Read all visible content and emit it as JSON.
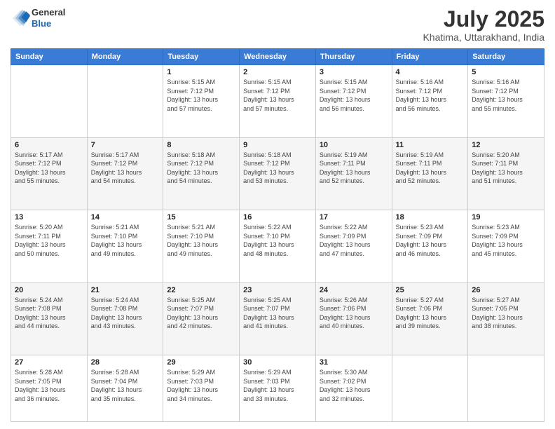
{
  "logo": {
    "line1": "General",
    "line2": "Blue"
  },
  "title": "July 2025",
  "subtitle": "Khatima, Uttarakhand, India",
  "days_of_week": [
    "Sunday",
    "Monday",
    "Tuesday",
    "Wednesday",
    "Thursday",
    "Friday",
    "Saturday"
  ],
  "weeks": [
    [
      {
        "day": "",
        "info": ""
      },
      {
        "day": "",
        "info": ""
      },
      {
        "day": "1",
        "info": "Sunrise: 5:15 AM\nSunset: 7:12 PM\nDaylight: 13 hours\nand 57 minutes."
      },
      {
        "day": "2",
        "info": "Sunrise: 5:15 AM\nSunset: 7:12 PM\nDaylight: 13 hours\nand 57 minutes."
      },
      {
        "day": "3",
        "info": "Sunrise: 5:15 AM\nSunset: 7:12 PM\nDaylight: 13 hours\nand 56 minutes."
      },
      {
        "day": "4",
        "info": "Sunrise: 5:16 AM\nSunset: 7:12 PM\nDaylight: 13 hours\nand 56 minutes."
      },
      {
        "day": "5",
        "info": "Sunrise: 5:16 AM\nSunset: 7:12 PM\nDaylight: 13 hours\nand 55 minutes."
      }
    ],
    [
      {
        "day": "6",
        "info": "Sunrise: 5:17 AM\nSunset: 7:12 PM\nDaylight: 13 hours\nand 55 minutes."
      },
      {
        "day": "7",
        "info": "Sunrise: 5:17 AM\nSunset: 7:12 PM\nDaylight: 13 hours\nand 54 minutes."
      },
      {
        "day": "8",
        "info": "Sunrise: 5:18 AM\nSunset: 7:12 PM\nDaylight: 13 hours\nand 54 minutes."
      },
      {
        "day": "9",
        "info": "Sunrise: 5:18 AM\nSunset: 7:12 PM\nDaylight: 13 hours\nand 53 minutes."
      },
      {
        "day": "10",
        "info": "Sunrise: 5:19 AM\nSunset: 7:11 PM\nDaylight: 13 hours\nand 52 minutes."
      },
      {
        "day": "11",
        "info": "Sunrise: 5:19 AM\nSunset: 7:11 PM\nDaylight: 13 hours\nand 52 minutes."
      },
      {
        "day": "12",
        "info": "Sunrise: 5:20 AM\nSunset: 7:11 PM\nDaylight: 13 hours\nand 51 minutes."
      }
    ],
    [
      {
        "day": "13",
        "info": "Sunrise: 5:20 AM\nSunset: 7:11 PM\nDaylight: 13 hours\nand 50 minutes."
      },
      {
        "day": "14",
        "info": "Sunrise: 5:21 AM\nSunset: 7:10 PM\nDaylight: 13 hours\nand 49 minutes."
      },
      {
        "day": "15",
        "info": "Sunrise: 5:21 AM\nSunset: 7:10 PM\nDaylight: 13 hours\nand 49 minutes."
      },
      {
        "day": "16",
        "info": "Sunrise: 5:22 AM\nSunset: 7:10 PM\nDaylight: 13 hours\nand 48 minutes."
      },
      {
        "day": "17",
        "info": "Sunrise: 5:22 AM\nSunset: 7:09 PM\nDaylight: 13 hours\nand 47 minutes."
      },
      {
        "day": "18",
        "info": "Sunrise: 5:23 AM\nSunset: 7:09 PM\nDaylight: 13 hours\nand 46 minutes."
      },
      {
        "day": "19",
        "info": "Sunrise: 5:23 AM\nSunset: 7:09 PM\nDaylight: 13 hours\nand 45 minutes."
      }
    ],
    [
      {
        "day": "20",
        "info": "Sunrise: 5:24 AM\nSunset: 7:08 PM\nDaylight: 13 hours\nand 44 minutes."
      },
      {
        "day": "21",
        "info": "Sunrise: 5:24 AM\nSunset: 7:08 PM\nDaylight: 13 hours\nand 43 minutes."
      },
      {
        "day": "22",
        "info": "Sunrise: 5:25 AM\nSunset: 7:07 PM\nDaylight: 13 hours\nand 42 minutes."
      },
      {
        "day": "23",
        "info": "Sunrise: 5:25 AM\nSunset: 7:07 PM\nDaylight: 13 hours\nand 41 minutes."
      },
      {
        "day": "24",
        "info": "Sunrise: 5:26 AM\nSunset: 7:06 PM\nDaylight: 13 hours\nand 40 minutes."
      },
      {
        "day": "25",
        "info": "Sunrise: 5:27 AM\nSunset: 7:06 PM\nDaylight: 13 hours\nand 39 minutes."
      },
      {
        "day": "26",
        "info": "Sunrise: 5:27 AM\nSunset: 7:05 PM\nDaylight: 13 hours\nand 38 minutes."
      }
    ],
    [
      {
        "day": "27",
        "info": "Sunrise: 5:28 AM\nSunset: 7:05 PM\nDaylight: 13 hours\nand 36 minutes."
      },
      {
        "day": "28",
        "info": "Sunrise: 5:28 AM\nSunset: 7:04 PM\nDaylight: 13 hours\nand 35 minutes."
      },
      {
        "day": "29",
        "info": "Sunrise: 5:29 AM\nSunset: 7:03 PM\nDaylight: 13 hours\nand 34 minutes."
      },
      {
        "day": "30",
        "info": "Sunrise: 5:29 AM\nSunset: 7:03 PM\nDaylight: 13 hours\nand 33 minutes."
      },
      {
        "day": "31",
        "info": "Sunrise: 5:30 AM\nSunset: 7:02 PM\nDaylight: 13 hours\nand 32 minutes."
      },
      {
        "day": "",
        "info": ""
      },
      {
        "day": "",
        "info": ""
      }
    ]
  ]
}
